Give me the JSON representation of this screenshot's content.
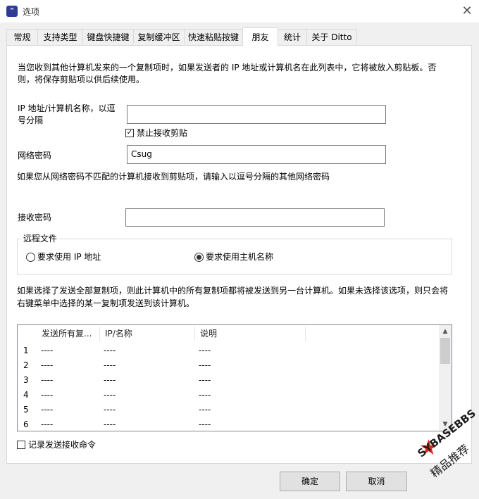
{
  "window": {
    "title": "选项",
    "close_glyph": "✕",
    "icon_glyph": "\""
  },
  "tabs": [
    {
      "label": "常规"
    },
    {
      "label": "支持类型"
    },
    {
      "label": "键盘快捷键"
    },
    {
      "label": "复制缓冲区"
    },
    {
      "label": "快速粘贴按键"
    },
    {
      "label": "朋友",
      "active": true
    },
    {
      "label": "统计"
    },
    {
      "label": "关于 Ditto"
    }
  ],
  "friends": {
    "intro_line1": "当您收到其他计算机发来的一个复制项时，如果发送者的 IP 地址或计算机名在此列表中，它将被放入剪贴板。否",
    "intro_line2": "则，将保存剪贴项以供后续使用。",
    "ip_label_line1": "IP 地址/计算机名称，以逗",
    "ip_label_line2": "号分隔",
    "ip_value": "",
    "disable_receive_label": "禁止接收剪贴",
    "disable_receive_checked": true,
    "network_password_label": "网络密码",
    "network_password_value": "Csug",
    "mismatch_note": "如果您从网络密码不匹配的计算机接收到剪贴项，请输入以逗号分隔的其他网络密码",
    "receive_password_label": "接收密码",
    "receive_password_value": "",
    "remote_files_title": "远程文件",
    "radio_ip_label": "要求使用 IP 地址",
    "radio_hostname_label": "要求使用主机名称",
    "radio_selected": "hostname",
    "send_note_line1": "如果选择了发送全部复制项，则此计算机中的所有复制项都将被发送到另一台计算机。如果未选择该选项，则只会将",
    "send_note_line2": "右键菜单中选择的某一复制项发送到该计算机。",
    "table": {
      "headers": [
        "发送所有复...",
        "IP/名称",
        "说明"
      ],
      "rows": [
        {
          "num": "1",
          "send_all": "----",
          "ip": "----",
          "desc": "----"
        },
        {
          "num": "2",
          "send_all": "----",
          "ip": "----",
          "desc": "----"
        },
        {
          "num": "3",
          "send_all": "----",
          "ip": "----",
          "desc": "----"
        },
        {
          "num": "4",
          "send_all": "----",
          "ip": "----",
          "desc": "----"
        },
        {
          "num": "5",
          "send_all": "----",
          "ip": "----",
          "desc": "----"
        },
        {
          "num": "6",
          "send_all": "----",
          "ip": "----",
          "desc": "----"
        }
      ]
    },
    "log_label": "记录发送接收命令",
    "log_checked": false
  },
  "buttons": {
    "ok": "确定",
    "cancel": "取消"
  },
  "watermark": {
    "line1": "SYBASEBBS",
    "line2": "精品推荐",
    "star": "★"
  },
  "colors": {
    "watermark_star": "#e0281e",
    "app_icon": "#2f3b94"
  }
}
